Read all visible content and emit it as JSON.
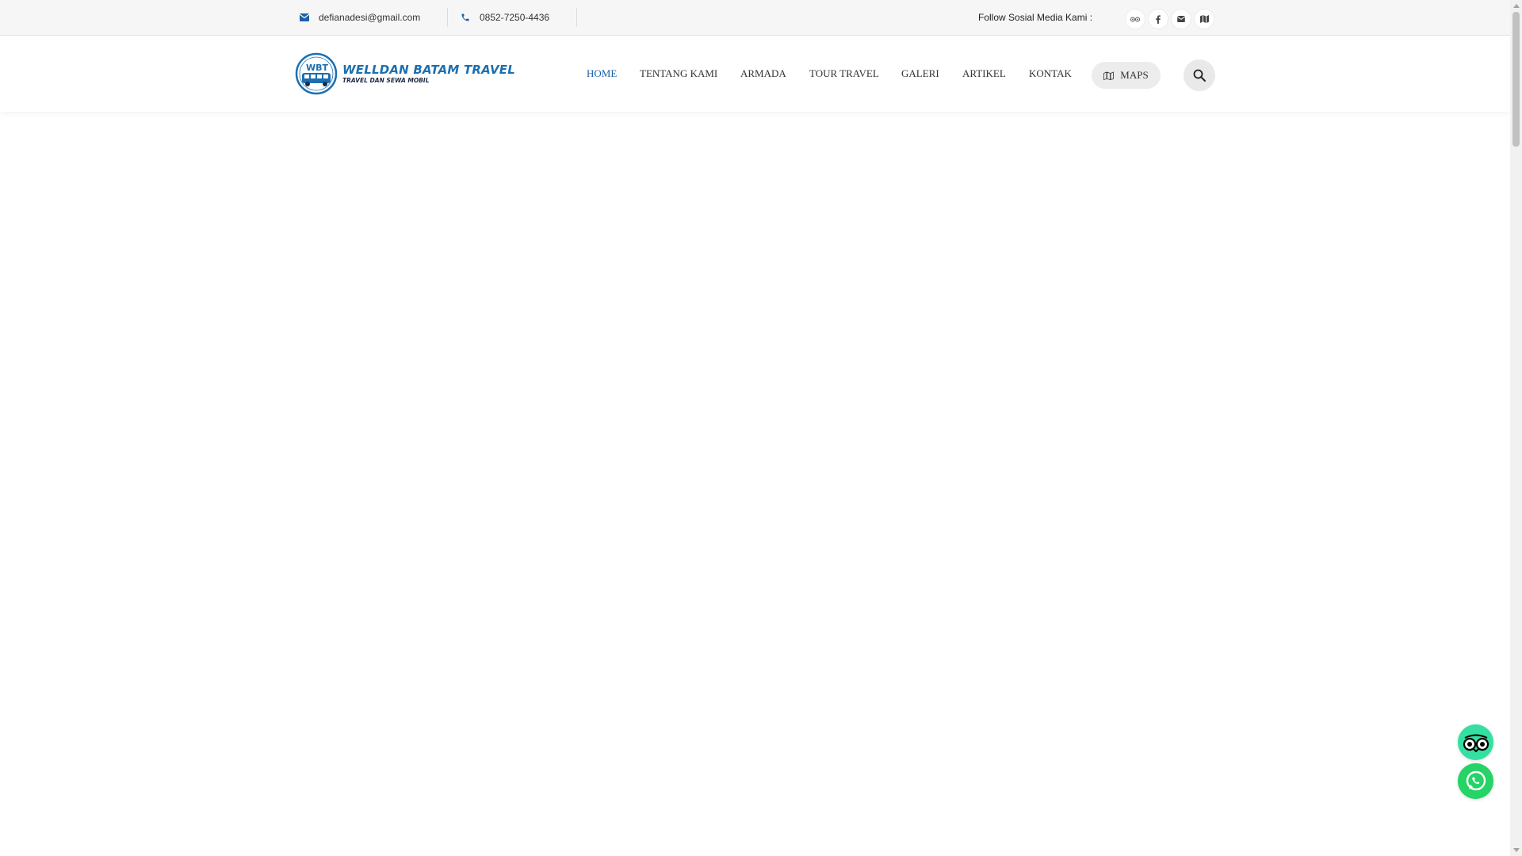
{
  "topbar": {
    "email": "defianadesi@gmail.com",
    "phone": "0852-7250-4436",
    "follow_label": "Follow Sosial Media Kami :",
    "social_icons": [
      "tripadvisor-icon",
      "facebook-icon",
      "email-icon",
      "maps-icon"
    ]
  },
  "logo": {
    "badge": "WBT",
    "title": "WELLDAN BATAM TRAVEL",
    "subtitle": "TRAVEL DAN SEWA MOBIL"
  },
  "nav": {
    "items": [
      {
        "label": "HOME",
        "active": true
      },
      {
        "label": "TENTANG KAMI",
        "active": false
      },
      {
        "label": "ARMADA",
        "active": false
      },
      {
        "label": "TOUR TRAVEL",
        "active": false
      },
      {
        "label": "GALERI",
        "active": false
      },
      {
        "label": "ARTIKEL",
        "active": false
      },
      {
        "label": "KONTAK",
        "active": false
      }
    ],
    "maps_label": "MAPS"
  },
  "floating": {
    "buttons": [
      "tripadvisor-icon",
      "whatsapp-icon"
    ]
  },
  "colors": {
    "accent": "#1a5fa8",
    "topbar_bg": "#f6f6f6",
    "whatsapp": "#25d366",
    "tripadvisor": "#34e0a1"
  }
}
